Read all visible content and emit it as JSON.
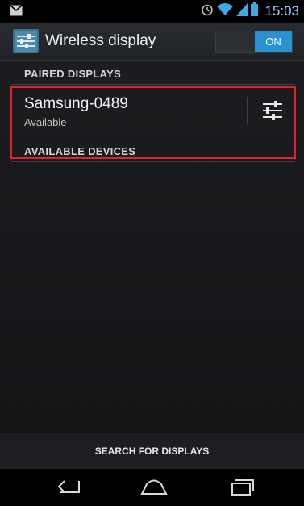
{
  "status_bar": {
    "time": "15:03",
    "icons": [
      "notification-icon",
      "alarm-icon",
      "wifi-icon",
      "signal-icon",
      "battery-icon"
    ]
  },
  "action_bar": {
    "title": "Wireless display",
    "toggle_label": "ON",
    "app_icon": "wireless-display-settings-icon"
  },
  "sections": {
    "paired_header": "PAIRED DISPLAYS",
    "available_header": "AVAILABLE DEVICES"
  },
  "paired_devices": [
    {
      "name": "Samsung-0489",
      "status": "Available",
      "action_icon": "device-settings-icon"
    }
  ],
  "bottom_bar": {
    "search_label": "SEARCH FOR DISPLAYS"
  },
  "nav_bar": {
    "icons": [
      "back-icon",
      "home-icon",
      "recent-apps-icon"
    ]
  },
  "colors": {
    "accent": "#2993d1",
    "status_time": "#9fd0ff",
    "highlight": "#e4202c"
  }
}
